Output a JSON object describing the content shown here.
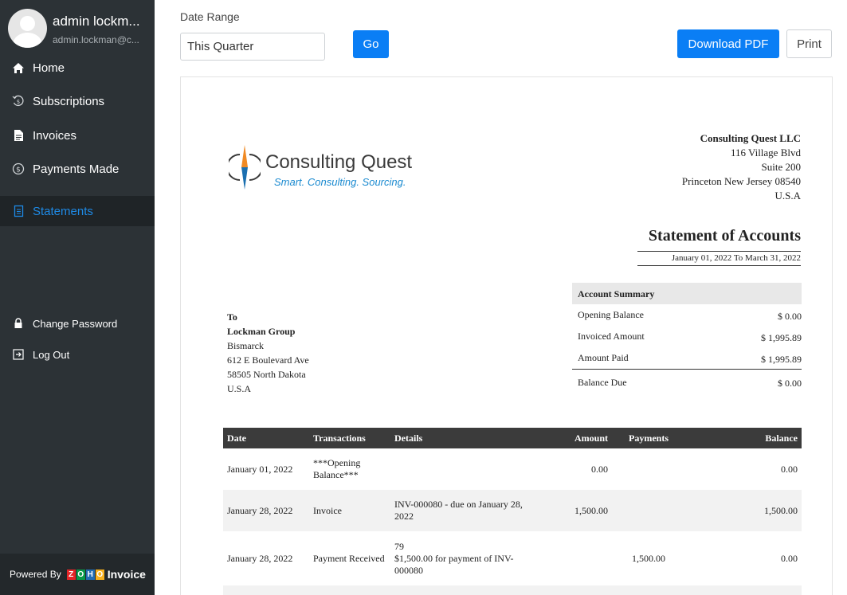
{
  "user": {
    "name": "admin lockm...",
    "email": "admin.lockman@c..."
  },
  "nav": {
    "home": "Home",
    "subscriptions": "Subscriptions",
    "invoices": "Invoices",
    "payments_made": "Payments Made",
    "statements": "Statements",
    "change_password": "Change Password",
    "log_out": "Log Out"
  },
  "footer": {
    "powered_by": "Powered By",
    "zoho_letters": [
      "Z",
      "O",
      "H",
      "O"
    ],
    "product": "Invoice"
  },
  "controls": {
    "date_range_label": "Date Range",
    "date_range_value": "This Quarter",
    "go_label": "Go",
    "download_pdf_label": "Download PDF",
    "print_label": "Print"
  },
  "statement": {
    "logo": {
      "name": "Consulting Quest",
      "tagline": "Smart. Consulting. Sourcing."
    },
    "org": {
      "name": "Consulting Quest LLC",
      "address1": "116 Village Blvd",
      "address2": "Suite 200",
      "city_line": "Princeton New Jersey 08540",
      "country": "U.S.A"
    },
    "title": "Statement of Accounts",
    "period": "January 01, 2022 To March 31, 2022",
    "summary": {
      "heading": "Account Summary",
      "opening_label": "Opening Balance",
      "opening_value": "$ 0.00",
      "invoiced_label": "Invoiced Amount",
      "invoiced_value": "$ 1,995.89",
      "paid_label": "Amount Paid",
      "paid_value": "$ 1,995.89",
      "due_label": "Balance Due",
      "due_value": "$ 0.00"
    },
    "to": {
      "label": "To",
      "name": "Lockman Group",
      "line1": "Bismarck",
      "line2": "612 E Boulevard Ave",
      "line3": "58505 North Dakota",
      "line4": "U.S.A"
    },
    "table": {
      "headers": {
        "date": "Date",
        "transactions": "Transactions",
        "details": "Details",
        "amount": "Amount",
        "payments": "Payments",
        "balance": "Balance"
      },
      "rows": [
        {
          "date": "January 01, 2022",
          "transaction": "***Opening Balance***",
          "details": "",
          "amount": "0.00",
          "payment": "",
          "balance": "0.00"
        },
        {
          "date": "January 28, 2022",
          "transaction": "Invoice",
          "details": "INV-000080 - due on January 28, 2022",
          "amount": "1,500.00",
          "payment": "",
          "balance": "1,500.00"
        },
        {
          "date": "January 28, 2022",
          "transaction": "Payment Received",
          "details_ref": "79",
          "details": "$1,500.00 for payment of INV-000080",
          "amount": "",
          "payment": "1,500.00",
          "balance": "0.00"
        }
      ]
    }
  },
  "colors": {
    "sidebar": "#2c3236",
    "accent": "#0a7ef5",
    "active_text": "#1e8ae6",
    "table_header": "#3b3b3b"
  }
}
